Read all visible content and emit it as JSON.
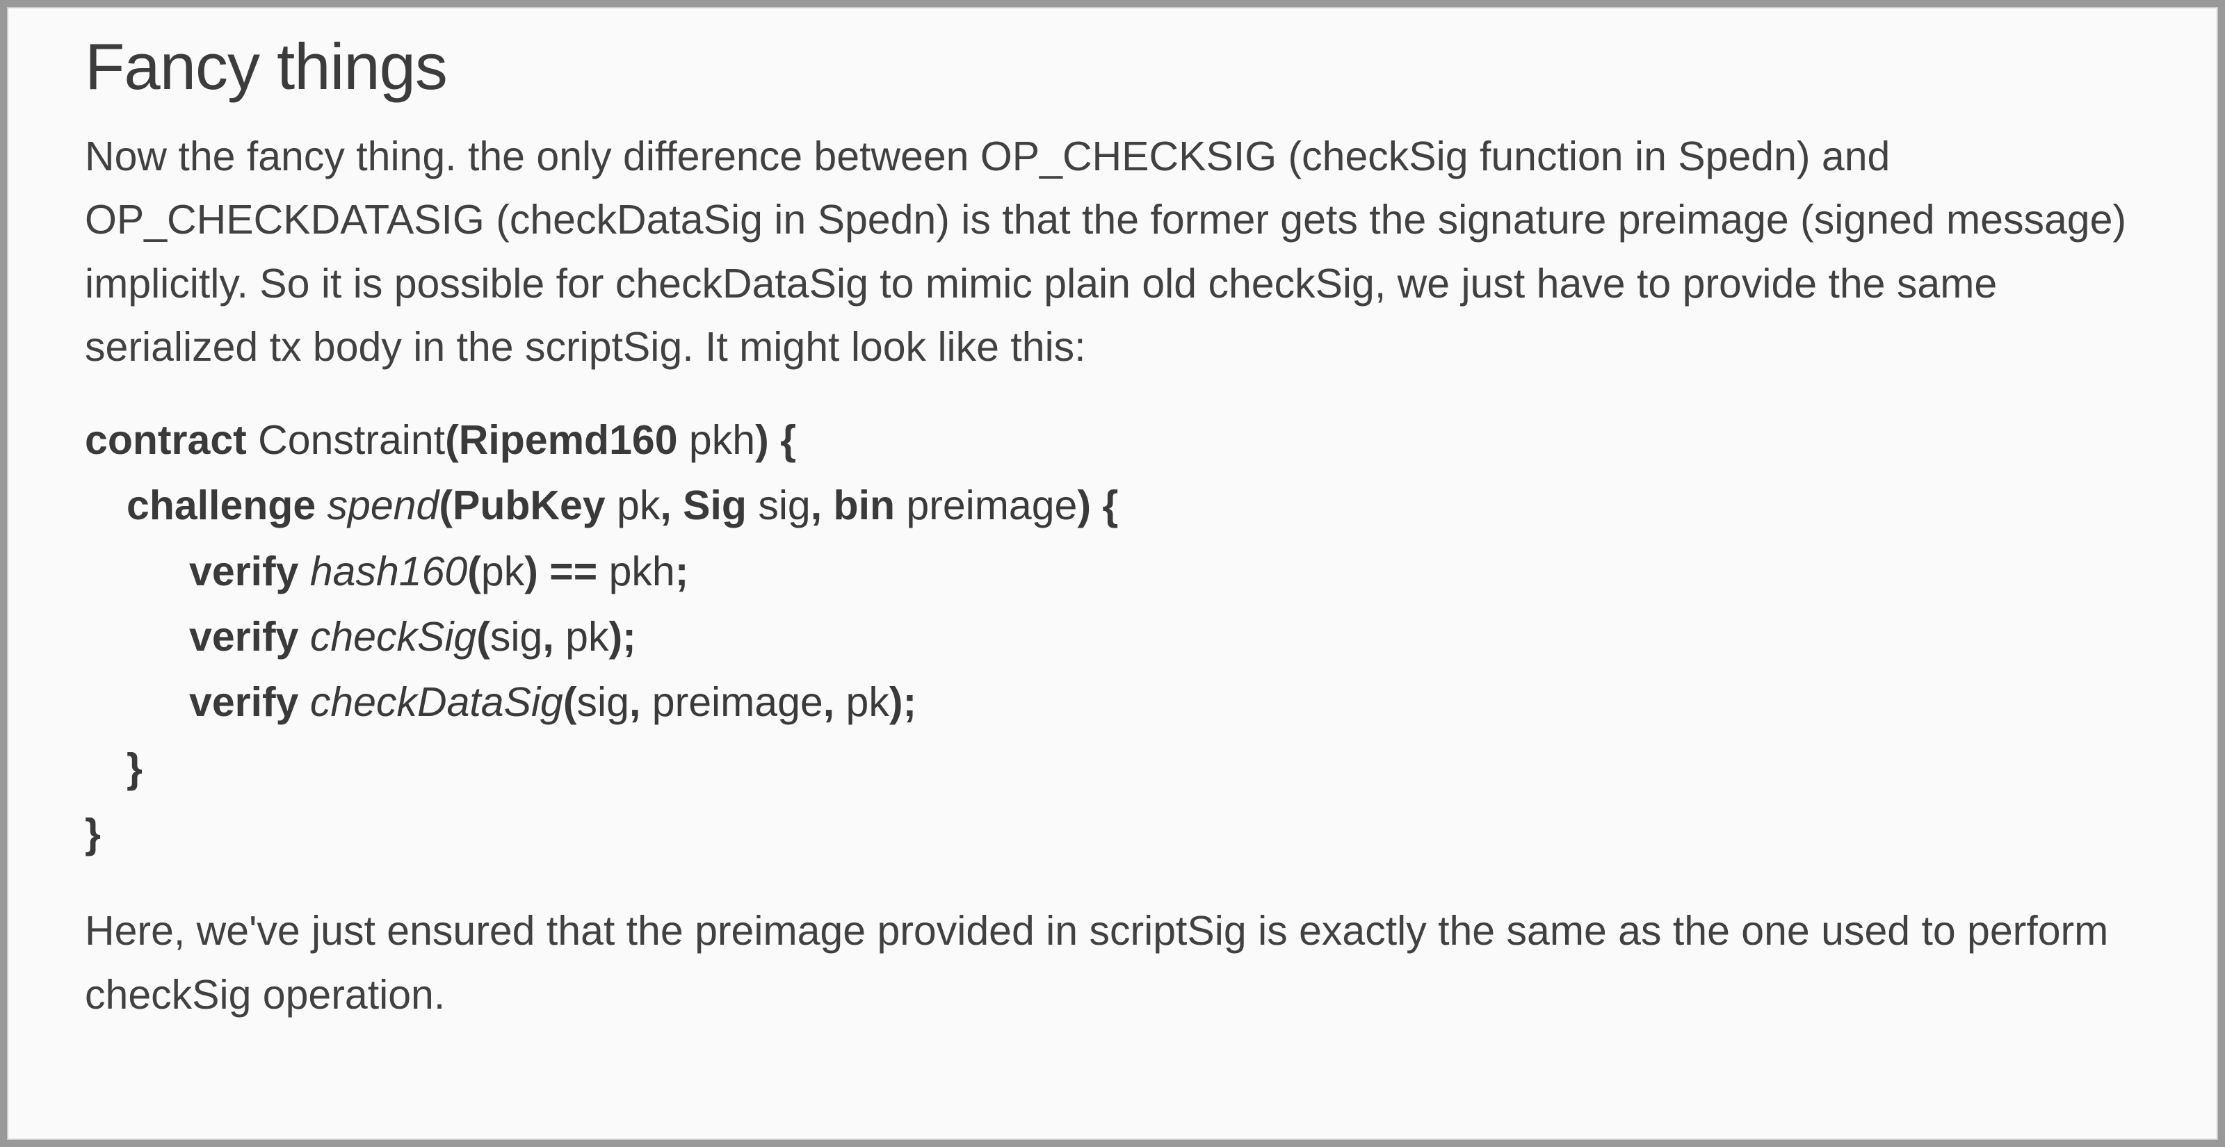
{
  "heading": "Fancy things",
  "para1": "Now the fancy thing. the only difference between OP_CHECKSIG (checkSig function in Spedn) and OP_CHECKDATASIG (checkDataSig in Spedn) is that the former gets the signature preimage (signed message) implicitly. So it is possible for checkDataSig to mimic plain old checkSig, we just have to provide the same serialized tx body in the scriptSig. It might look like this:",
  "code": {
    "l1a": "contract ",
    "l1b": "Constraint",
    "l1c": "(Ripemd160 ",
    "l1d": "pkh",
    "l1e": ") {",
    "l2a": "challenge ",
    "l2b": "spend",
    "l2c": "(PubKey ",
    "l2d": "pk",
    "l2e": ", Sig ",
    "l2f": "sig",
    "l2g": ", bin ",
    "l2h": "preimage",
    "l2i": ") {",
    "l3a": "verify ",
    "l3b": "hash160",
    "l3c": "(",
    "l3d": "pk",
    "l3e": ") == ",
    "l3f": "pkh",
    "l3g": ";",
    "l4a": "verify ",
    "l4b": "checkSig",
    "l4c": "(",
    "l4d": "sig",
    "l4e": ", ",
    "l4f": "pk",
    "l4g": ");",
    "l5a": "verify ",
    "l5b": "checkDataSig",
    "l5c": "(",
    "l5d": "sig",
    "l5e": ", ",
    "l5f": "preimage",
    "l5g": ", ",
    "l5h": "pk",
    "l5i": ");",
    "l6": "}",
    "l7": "}"
  },
  "para2": "Here, we've just ensured that the preimage provided in scriptSig is exactly the same as the one used to perform checkSig operation."
}
